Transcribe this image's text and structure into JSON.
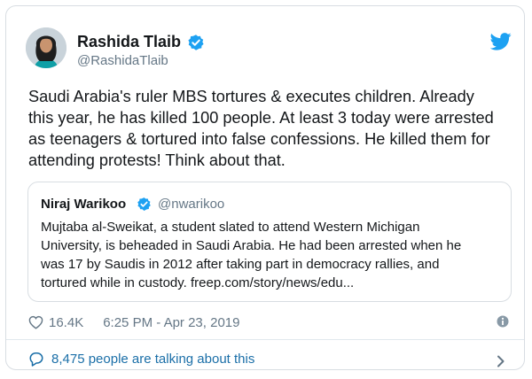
{
  "tweet": {
    "author_name": "Rashida Tlaib",
    "author_handle": "@RashidaTlaib",
    "text": "Saudi Arabia's ruler MBS tortures & executes children. Already\nthis year, he has killed 100 people. At least 3 today were arrested\nas teenagers & tortured into false confessions. He killed them for\nattending protests! Think about that.",
    "likes": "16.4K",
    "timestamp": "6:25 PM - Apr 23, 2019",
    "talking": "8,475 people are talking about this"
  },
  "quoted": {
    "author_name": "Niraj Warikoo",
    "author_handle": "@nwarikoo",
    "text": "Mujtaba al-Sweikat, a student slated to attend Western Michigan\nUniversity, is beheaded in Saudi Arabia. He had been arrested when he\nwas 17 by Saudis in 2012 after taking part in democracy rallies, and\ntortured while in custody. freep.com/story/news/edu..."
  },
  "colors": {
    "brand": "#1da1f2",
    "link": "#1b6fa8",
    "muted": "#657786"
  },
  "icons": [
    "verified-icon",
    "twitter-bird-icon",
    "heart-icon",
    "info-icon",
    "speech-bubble-icon",
    "chevron-right-icon"
  ]
}
